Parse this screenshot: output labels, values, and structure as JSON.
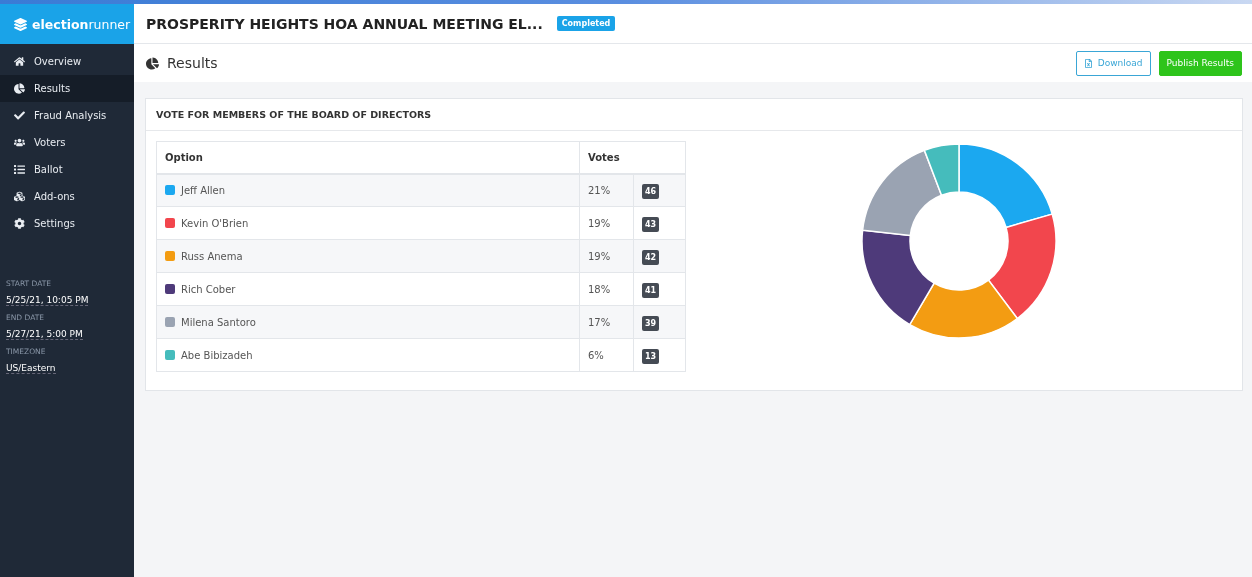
{
  "brand": {
    "name_bold": "election",
    "name_light": "runner"
  },
  "header": {
    "title": "PROSPERITY HEIGHTS HOA ANNUAL MEETING EL...",
    "status": "Completed"
  },
  "sidebar": {
    "items": [
      {
        "label": "Overview",
        "selected": false
      },
      {
        "label": "Results",
        "selected": true
      },
      {
        "label": "Fraud Analysis",
        "selected": false
      },
      {
        "label": "Voters",
        "selected": false
      },
      {
        "label": "Ballot",
        "selected": false
      },
      {
        "label": "Add-ons",
        "selected": false
      },
      {
        "label": "Settings",
        "selected": false
      }
    ],
    "details": [
      {
        "label": "START DATE",
        "value": "5/25/21, 10:05 PM"
      },
      {
        "label": "END DATE",
        "value": "5/27/21, 5:00 PM"
      },
      {
        "label": "TIMEZONE",
        "value": "US/Eastern"
      }
    ]
  },
  "page": {
    "title": "Results",
    "buttons": [
      {
        "label": "Download",
        "kind": "outline"
      },
      {
        "label": "Publish Results",
        "kind": "primary"
      }
    ]
  },
  "question": {
    "title": "VOTE FOR MEMBERS OF THE BOARD OF DIRECTORS",
    "columns": [
      "Option",
      "Votes"
    ],
    "options": [
      {
        "name": "Jeff Allen",
        "color": "#1ba8f0",
        "percent": "21%",
        "votes": "46"
      },
      {
        "name": "Kevin O'Brien",
        "color": "#f2464d",
        "percent": "19%",
        "votes": "43"
      },
      {
        "name": "Russ Anema",
        "color": "#f39c12",
        "percent": "19%",
        "votes": "42"
      },
      {
        "name": "Rich Cober",
        "color": "#4e3a7a",
        "percent": "18%",
        "votes": "41"
      },
      {
        "name": "Milena Santoro",
        "color": "#9aa3b2",
        "percent": "17%",
        "votes": "39"
      },
      {
        "name": "Abe Bibizadeh",
        "color": "#45bcbc",
        "percent": "6%",
        "votes": "13"
      }
    ]
  }
}
